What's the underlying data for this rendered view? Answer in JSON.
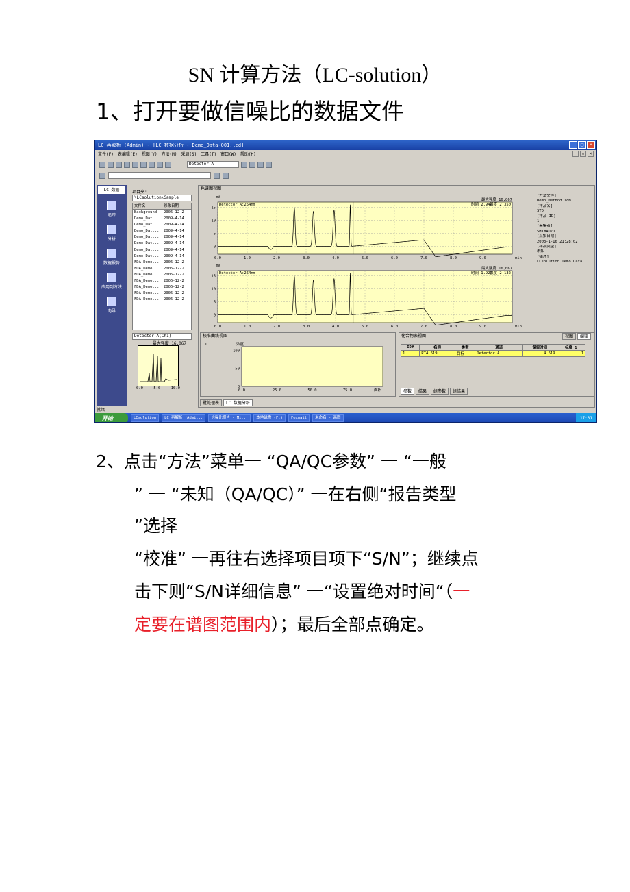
{
  "document": {
    "title": "SN 计算方法（LC-solution）",
    "step1": "1、打开要做信噪比的数据文件",
    "step2_lines": [
      "2、点击“方法”菜单一 “QA/QC参数” 一 “一般",
      "” 一 “未知（QA/QC）” 一在右侧“报告类型",
      "”选择",
      "“校准” 一再往右选择项目项下“S/N”；继续点",
      "击下则“S/N详细信息” 一“设置绝对时间“（"
    ],
    "step2_red_tail": "一",
    "step2_last_red": "定要在谱图范围内",
    "step2_last_black": "）；最后全部点确定。"
  },
  "screenshot": {
    "title": "LC 再解析 (Admin) - [LC 数据分析 - Demo_Data-001.lcd]",
    "menu": [
      "文件(F)",
      "表编辑(E)",
      "视图(V)",
      "方法(M)",
      "采局(S)",
      "工具(T)",
      "窗口(W)",
      "帮助(H)"
    ],
    "detector": "Detector A",
    "left_nav": {
      "header": "LC 数据",
      "items": [
        "追踪",
        "分析",
        "数据报告",
        "应用到方法",
        "向导"
      ]
    },
    "file_panel": {
      "label": "项目夹:",
      "path": "\\LCsolution\\Sample",
      "columns": [
        "文件名",
        "修改日期"
      ],
      "rows": [
        [
          "Background",
          "2006-12-2"
        ],
        [
          "Demo_Dat...",
          "2009-4-14"
        ],
        [
          "Demo_Dat...",
          "2009-4-14"
        ],
        [
          "Demo_Dat...",
          "2009-4-14"
        ],
        [
          "Demo_Dat...",
          "2009-4-14"
        ],
        [
          "Demo_Dat...",
          "2009-4-14"
        ],
        [
          "Demo_Dat...",
          "2009-4-14"
        ],
        [
          "Demo_Dat...",
          "2009-4-14"
        ],
        [
          "FDA_Demo...",
          "2006-12-2"
        ],
        [
          "FDA_Demo...",
          "2006-12-2"
        ],
        [
          "FDA_Demo...",
          "2006-12-2"
        ],
        [
          "FDA_Demo...",
          "2006-12-2"
        ],
        [
          "FDA_Demo...",
          "2006-12-2"
        ],
        [
          "FDA_Demo...",
          "2006-12-2"
        ],
        [
          "FDA_Demo...",
          "2006-12-2"
        ]
      ],
      "detector": "Detector A(Ch1)",
      "max_label": "最大强度 16,067",
      "thumb_ticks": [
        "0.0",
        "5.0",
        "10.0"
      ]
    },
    "chrom": {
      "panel_title": "色谱图视图",
      "y_unit": "mV",
      "x_unit": "min",
      "plots": [
        {
          "label": "Detector A:254nm",
          "max": "最大强度 16,067",
          "time_label": "时间",
          "time": "2.940",
          "intensity_label": "强度",
          "intensity": "2.350"
        },
        {
          "label": "Detector A:254nm",
          "max": "最大强度 16,067",
          "time_label": "时间",
          "time": "1.920",
          "intensity_label": "强度",
          "intensity": "2.132"
        }
      ],
      "y_ticks": [
        "15",
        "10",
        "5",
        "0"
      ],
      "x_ticks": [
        "0.0",
        "1.0",
        "2.0",
        "3.0",
        "4.0",
        "5.0",
        "6.0",
        "7.0",
        "8.0",
        "9.0"
      ]
    },
    "info_panel": [
      "[方法文件]",
      "Demo_Method.lcm",
      "[样品名]",
      "STD",
      "[样品 ID]",
      "1",
      "[采集者]",
      "SHIMADZU",
      "[采集日期]",
      "2003-1-16 21:28:02",
      "[样品类型]",
      "未知",
      "[描述]",
      "LCsolution Demo Data"
    ],
    "calib": {
      "title": "校准曲线视图",
      "num": "1",
      "y_label": "浓度",
      "y_ticks": [
        "100",
        "50",
        "0"
      ],
      "x_ticks": [
        "0.0",
        "25.0",
        "50.0",
        "75.0"
      ],
      "x_unit": "面积"
    },
    "compound": {
      "title": "化合物表视图",
      "tabs_right": [
        "视图",
        "编辑"
      ],
      "columns": [
        "ID#",
        "名称",
        "类型",
        "通道",
        "保留时间",
        "标度 1"
      ],
      "rows": [
        [
          "1",
          "RT4.619",
          "目标",
          "Detector A",
          "4.619",
          "1"
        ]
      ],
      "bottom_tabs": [
        "参数",
        "结果",
        "组参数",
        "组结果"
      ]
    },
    "bottom_tabs": [
      "批处理表",
      "LC 数据分析"
    ],
    "status": "就绪",
    "taskbar": {
      "start": "开始",
      "tasks": [
        "LCsolution",
        "LC 再解析 (Admi...",
        "信噪比报告 - Mi...",
        "本地磁盘 (F:)",
        "Foxmail",
        "未命名 - 画图"
      ],
      "clock": "17:31"
    }
  }
}
